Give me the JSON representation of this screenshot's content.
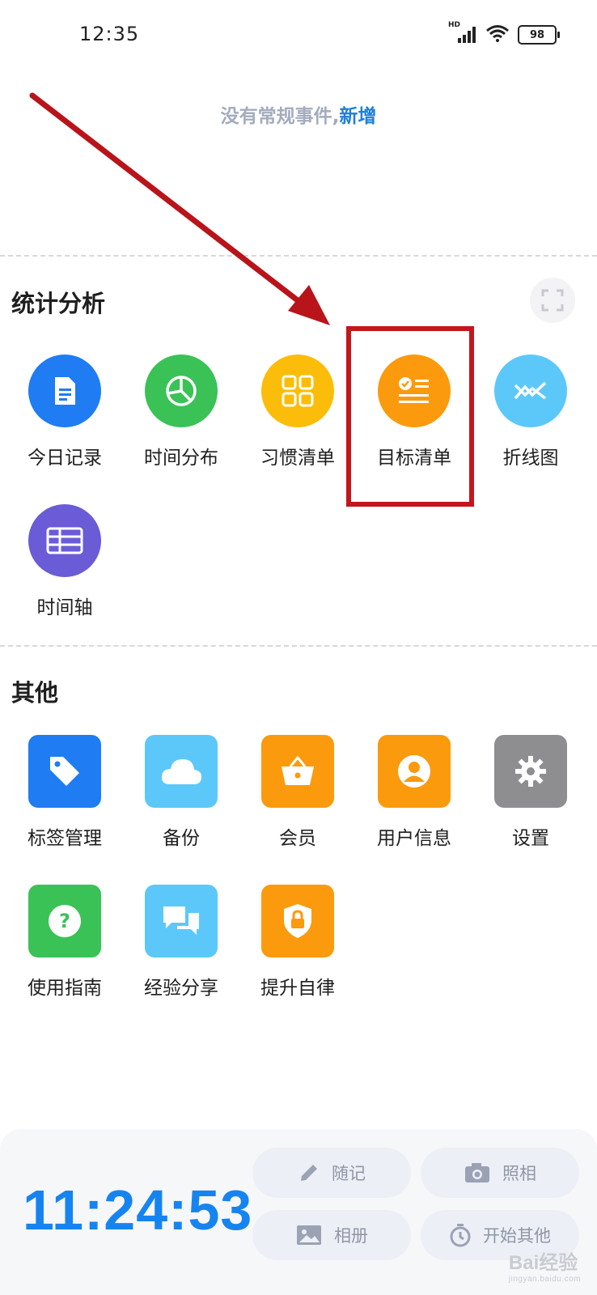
{
  "status_bar": {
    "time": "12:35",
    "network": "HD",
    "battery": "98"
  },
  "no_event": {
    "text": "没有常规事件,",
    "action": "新增"
  },
  "stats": {
    "title": "统计分析",
    "items": [
      {
        "label": "今日记录",
        "icon": "document-icon",
        "color": "#1f7cf3"
      },
      {
        "label": "时间分布",
        "icon": "pie-chart-icon",
        "color": "#3ac256"
      },
      {
        "label": "习惯清单",
        "icon": "grid-icon",
        "color": "#fbbd09"
      },
      {
        "label": "目标清单",
        "icon": "checklist-icon",
        "color": "#fb9a0d"
      },
      {
        "label": "折线图",
        "icon": "line-chart-icon",
        "color": "#5cc8fa"
      },
      {
        "label": "时间轴",
        "icon": "table-icon",
        "color": "#6a5cd6"
      }
    ]
  },
  "other": {
    "title": "其他",
    "items": [
      {
        "label": "标签管理",
        "icon": "tag-icon",
        "color": "#1f7cf3"
      },
      {
        "label": "备份",
        "icon": "cloud-icon",
        "color": "#5cc8fa"
      },
      {
        "label": "会员",
        "icon": "basket-icon",
        "color": "#fb9a0d"
      },
      {
        "label": "用户信息",
        "icon": "user-icon",
        "color": "#fb9a0d"
      },
      {
        "label": "设置",
        "icon": "gear-icon",
        "color": "#8e8e90"
      },
      {
        "label": "使用指南",
        "icon": "question-icon",
        "color": "#3ac256"
      },
      {
        "label": "经验分享",
        "icon": "chat-icon",
        "color": "#5cc8fa"
      },
      {
        "label": "提升自律",
        "icon": "shield-lock-icon",
        "color": "#fb9a0d"
      }
    ]
  },
  "bottom": {
    "timer": "11:24:53",
    "actions": [
      {
        "label": "随记",
        "icon": "pencil-icon"
      },
      {
        "label": "照相",
        "icon": "camera-icon"
      },
      {
        "label": "相册",
        "icon": "image-icon"
      },
      {
        "label": "开始其他",
        "icon": "stopwatch-icon"
      }
    ]
  },
  "watermark": {
    "brand": "Bai经验",
    "url": "jingyan.baidu.com"
  },
  "colors": {
    "accent": "#1684f0",
    "annotation": "#c2161c"
  }
}
